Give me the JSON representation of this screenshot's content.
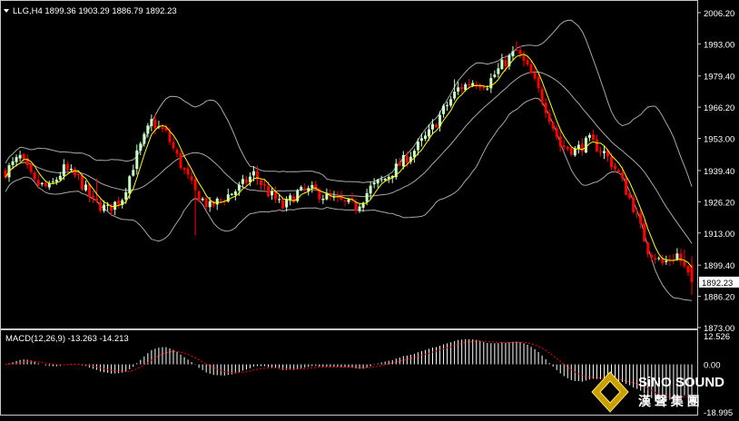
{
  "colors": {
    "background": "#000000",
    "frame": "#c8c8c8",
    "text": "#ffffff",
    "bull": "#c8ffc8",
    "bear": "#ff0000",
    "ma": "#ffff00",
    "bands": "#a8a8a8",
    "macd_hist": "#ffffff",
    "macd_signal": "#ff0000",
    "price_tag_bg": "#ffffff",
    "price_tag_text": "#000000"
  },
  "chart_data": [
    {
      "type": "candlestick",
      "title": "LLG,H4 1899.36 1903.29 1886.79 1892.23",
      "symbol": "LLG,H4",
      "ohlc_header": [
        "1899.36",
        "1903.29",
        "1886.79",
        "1892.23"
      ],
      "ylim": [
        1873.0,
        2010.0
      ],
      "y_ticks": [
        "2006.20",
        "1993.00",
        "1979.40",
        "1966.20",
        "1953.00",
        "1939.40",
        "1926.20",
        "1913.00",
        "1899.40",
        "1886.20",
        "1873.00"
      ],
      "last_price": "1892.23",
      "grid": false,
      "overlays": [
        "moving average",
        "bollinger bands"
      ],
      "anchors": [
        [
          0,
          1939
        ],
        [
          4,
          1945
        ],
        [
          8,
          1934
        ],
        [
          12,
          1932
        ],
        [
          16,
          1940
        ],
        [
          20,
          1936
        ],
        [
          24,
          1926
        ],
        [
          28,
          1923
        ],
        [
          32,
          1928
        ],
        [
          36,
          1946
        ],
        [
          40,
          1960
        ],
        [
          44,
          1955
        ],
        [
          48,
          1942
        ],
        [
          52,
          1930
        ],
        [
          56,
          1924
        ],
        [
          60,
          1928
        ],
        [
          64,
          1932
        ],
        [
          68,
          1938
        ],
        [
          72,
          1930
        ],
        [
          76,
          1924
        ],
        [
          80,
          1930
        ],
        [
          84,
          1931
        ],
        [
          88,
          1928
        ],
        [
          92,
          1926
        ],
        [
          96,
          1924
        ],
        [
          100,
          1932
        ],
        [
          104,
          1936
        ],
        [
          108,
          1942
        ],
        [
          112,
          1948
        ],
        [
          116,
          1955
        ],
        [
          120,
          1965
        ],
        [
          124,
          1974
        ],
        [
          128,
          1977
        ],
        [
          132,
          1976
        ],
        [
          136,
          1984
        ],
        [
          140,
          1990
        ],
        [
          144,
          1980
        ],
        [
          148,
          1966
        ],
        [
          152,
          1950
        ],
        [
          156,
          1948
        ],
        [
          160,
          1952
        ],
        [
          164,
          1947
        ],
        [
          168,
          1938
        ],
        [
          172,
          1924
        ],
        [
          176,
          1906
        ],
        [
          180,
          1900
        ],
        [
          184,
          1904
        ],
        [
          188,
          1892
        ]
      ],
      "spikes": [
        [
          25,
          1936,
          1927
        ],
        [
          40,
          1962,
          1956
        ],
        [
          52,
          1915,
          1912
        ],
        [
          123,
          1978,
          1973
        ],
        [
          140,
          1994,
          1990
        ],
        [
          186,
          1906,
          1902
        ]
      ],
      "bb_period": 20,
      "bb_deviation": 2,
      "ma_period": 5
    },
    {
      "type": "macd",
      "label": "MACD(12,26,9) -13.263 -14.213",
      "indicator": "MACD(12,26,9)",
      "values_header": [
        "-13.263",
        "-14.213"
      ],
      "fast": 12,
      "slow": 26,
      "signal": 9,
      "ylim": [
        -18.995,
        12.526
      ],
      "y_ticks": [
        "12.526",
        "0.00",
        "-18.995"
      ],
      "grid": false
    }
  ],
  "logo": {
    "name": "SiNO SOUND",
    "subtitle": "漢 聲 集 團"
  }
}
